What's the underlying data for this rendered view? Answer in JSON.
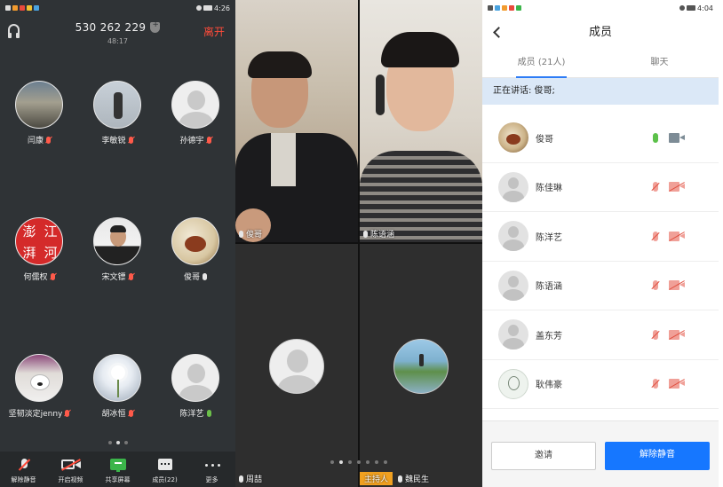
{
  "left": {
    "status_time": "4:26",
    "meeting_number": "530 262 229",
    "duration": "48:17",
    "leave_label": "离开",
    "participants": [
      {
        "name": "闫康",
        "mic": "red",
        "avatar": "photo-dusk"
      },
      {
        "name": "李敏锐",
        "mic": "red",
        "avatar": "photo-silhouette"
      },
      {
        "name": "孙德宇",
        "mic": "red",
        "avatar": "default"
      },
      {
        "name": "何儒权",
        "mic": "red",
        "avatar": "seal"
      },
      {
        "name": "宋文镖",
        "mic": "red",
        "avatar": "photo-man"
      },
      {
        "name": "俊哥",
        "mic": "white",
        "avatar": "teapot"
      },
      {
        "name": "坚韧淡定jenny",
        "mic": "red",
        "avatar": "photo-dog"
      },
      {
        "name": "胡冰恒",
        "mic": "red",
        "avatar": "photo-flower"
      },
      {
        "name": "陈洋艺",
        "mic": "green",
        "avatar": "default"
      }
    ],
    "seal_text": [
      "澎",
      "江",
      "湃",
      "河"
    ],
    "toolbar": [
      {
        "label": "解除静音",
        "icon": "muted-mic-icon"
      },
      {
        "label": "开启视频",
        "icon": "video-off-icon"
      },
      {
        "label": "共享屏幕",
        "icon": "share-screen-icon"
      },
      {
        "label": "成员(22)",
        "icon": "members-icon"
      },
      {
        "label": "更多",
        "icon": "more-icon"
      }
    ]
  },
  "middle": {
    "videos": [
      {
        "name": "俊哥"
      },
      {
        "name": "陈语涵"
      },
      {
        "name": "周喆"
      },
      {
        "name": "魏民生",
        "badge": "主持人"
      }
    ]
  },
  "right": {
    "status_time": "4:04",
    "title": "成员",
    "tabs": [
      "成员 (21人)",
      "聊天"
    ],
    "speaking": "正在讲话: 俊哥;",
    "members": [
      {
        "name": "俊哥",
        "mic": "on",
        "cam": "on",
        "avatar": "teapot"
      },
      {
        "name": "陈佳琳",
        "mic": "off",
        "cam": "off",
        "avatar": "default"
      },
      {
        "name": "陈洋艺",
        "mic": "off",
        "cam": "off",
        "avatar": "default"
      },
      {
        "name": "陈语涵",
        "mic": "off",
        "cam": "off",
        "avatar": "default"
      },
      {
        "name": "盖东芳",
        "mic": "off",
        "cam": "off",
        "avatar": "default"
      },
      {
        "name": "耿伟豪",
        "mic": "off",
        "cam": "off",
        "avatar": "sketch"
      }
    ],
    "invite_label": "邀请",
    "unmute_label": "解除静音"
  }
}
